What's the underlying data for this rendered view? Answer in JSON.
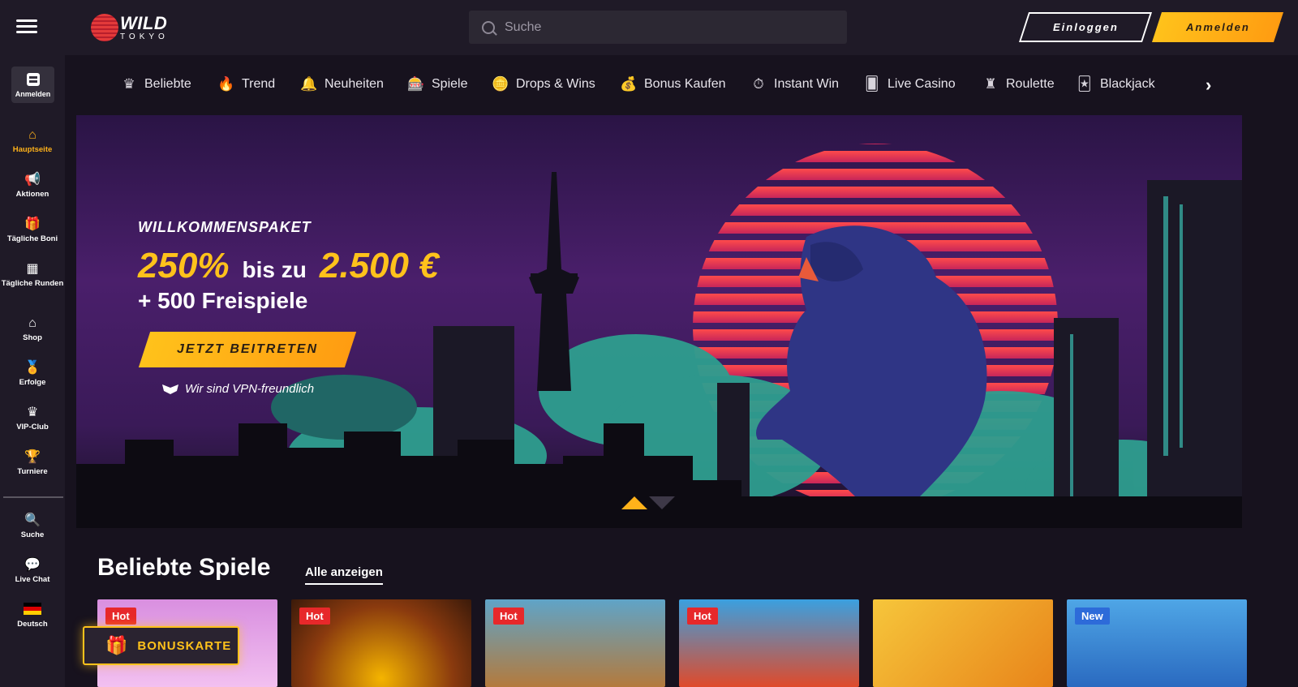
{
  "header": {
    "logo_main": "WILD",
    "logo_sub": "TOKYO",
    "search_placeholder": "Suche",
    "login_label": "Einloggen",
    "register_label": "Anmelden"
  },
  "sidebar": {
    "login_label": "Anmelden",
    "items": [
      {
        "label": "Hauptseite",
        "icon": "home-icon",
        "glyph": "⌂"
      },
      {
        "label": "Aktionen",
        "icon": "megaphone-icon",
        "glyph": "📢"
      },
      {
        "label": "Tägliche Boni",
        "icon": "gift-icon",
        "glyph": "🎁"
      },
      {
        "label": "Tägliche Runden",
        "icon": "calendar-icon",
        "glyph": "▦"
      },
      {
        "label": "Shop",
        "icon": "shop-icon",
        "glyph": "⌂"
      },
      {
        "label": "Erfolge",
        "icon": "medal-icon",
        "glyph": "🏅"
      },
      {
        "label": "VIP-Club",
        "icon": "crown-icon",
        "glyph": "♛"
      },
      {
        "label": "Turniere",
        "icon": "trophy-icon",
        "glyph": "🏆"
      },
      {
        "label": "Suche",
        "icon": "search-icon",
        "glyph": "🔍"
      },
      {
        "label": "Live Chat",
        "icon": "chat-icon",
        "glyph": "💬"
      },
      {
        "label": "Deutsch",
        "icon": "german-flag-icon",
        "glyph": ""
      }
    ],
    "active_color": "#ffb21a"
  },
  "categories": [
    {
      "label": "Beliebte",
      "icon": "crown-icon",
      "glyph": "♛"
    },
    {
      "label": "Trend",
      "icon": "flame-icon",
      "glyph": "🔥"
    },
    {
      "label": "Neuheiten",
      "icon": "bell-icon",
      "glyph": "🔔"
    },
    {
      "label": "Spiele",
      "icon": "slot-machine-icon",
      "glyph": "🎰"
    },
    {
      "label": "Drops & Wins",
      "icon": "coins-icon",
      "glyph": "🪙"
    },
    {
      "label": "Bonus Kaufen",
      "icon": "money-bag-icon",
      "glyph": "💰"
    },
    {
      "label": "Instant Win",
      "icon": "stopwatch-icon",
      "glyph": "⏱"
    },
    {
      "label": "Live Casino",
      "icon": "dealer-icon",
      "glyph": "🂠"
    },
    {
      "label": "Roulette",
      "icon": "roulette-icon",
      "glyph": "♜"
    },
    {
      "label": "Blackjack",
      "icon": "cards-icon",
      "glyph": "🃏"
    }
  ],
  "hero": {
    "welcome": "WILLKOMMENSPAKET",
    "percent": "250%",
    "up_to": "bis zu",
    "amount": "2.500 €",
    "free_spins": "+ 500 Freispiele",
    "cta": "JETZT BEITRETEN",
    "vpn_note": "Wir sind VPN-freundlich"
  },
  "games_section": {
    "title": "Beliebte Spiele",
    "show_all": "Alle anzeigen",
    "games": [
      {
        "badge": "Hot",
        "badge_type": "hot"
      },
      {
        "badge": "Hot",
        "badge_type": "hot"
      },
      {
        "badge": "Hot",
        "badge_type": "hot"
      },
      {
        "badge": "Hot",
        "badge_type": "hot"
      },
      {
        "badge": "",
        "badge_type": "none"
      },
      {
        "badge": "New",
        "badge_type": "new"
      }
    ]
  },
  "bonus_card": {
    "label": "BONUSKARTE"
  },
  "colors": {
    "accent": "#ffc21b",
    "accent_dark": "#ff9c11",
    "hot_badge": "#e7282a",
    "new_badge": "#2d6bd9"
  }
}
